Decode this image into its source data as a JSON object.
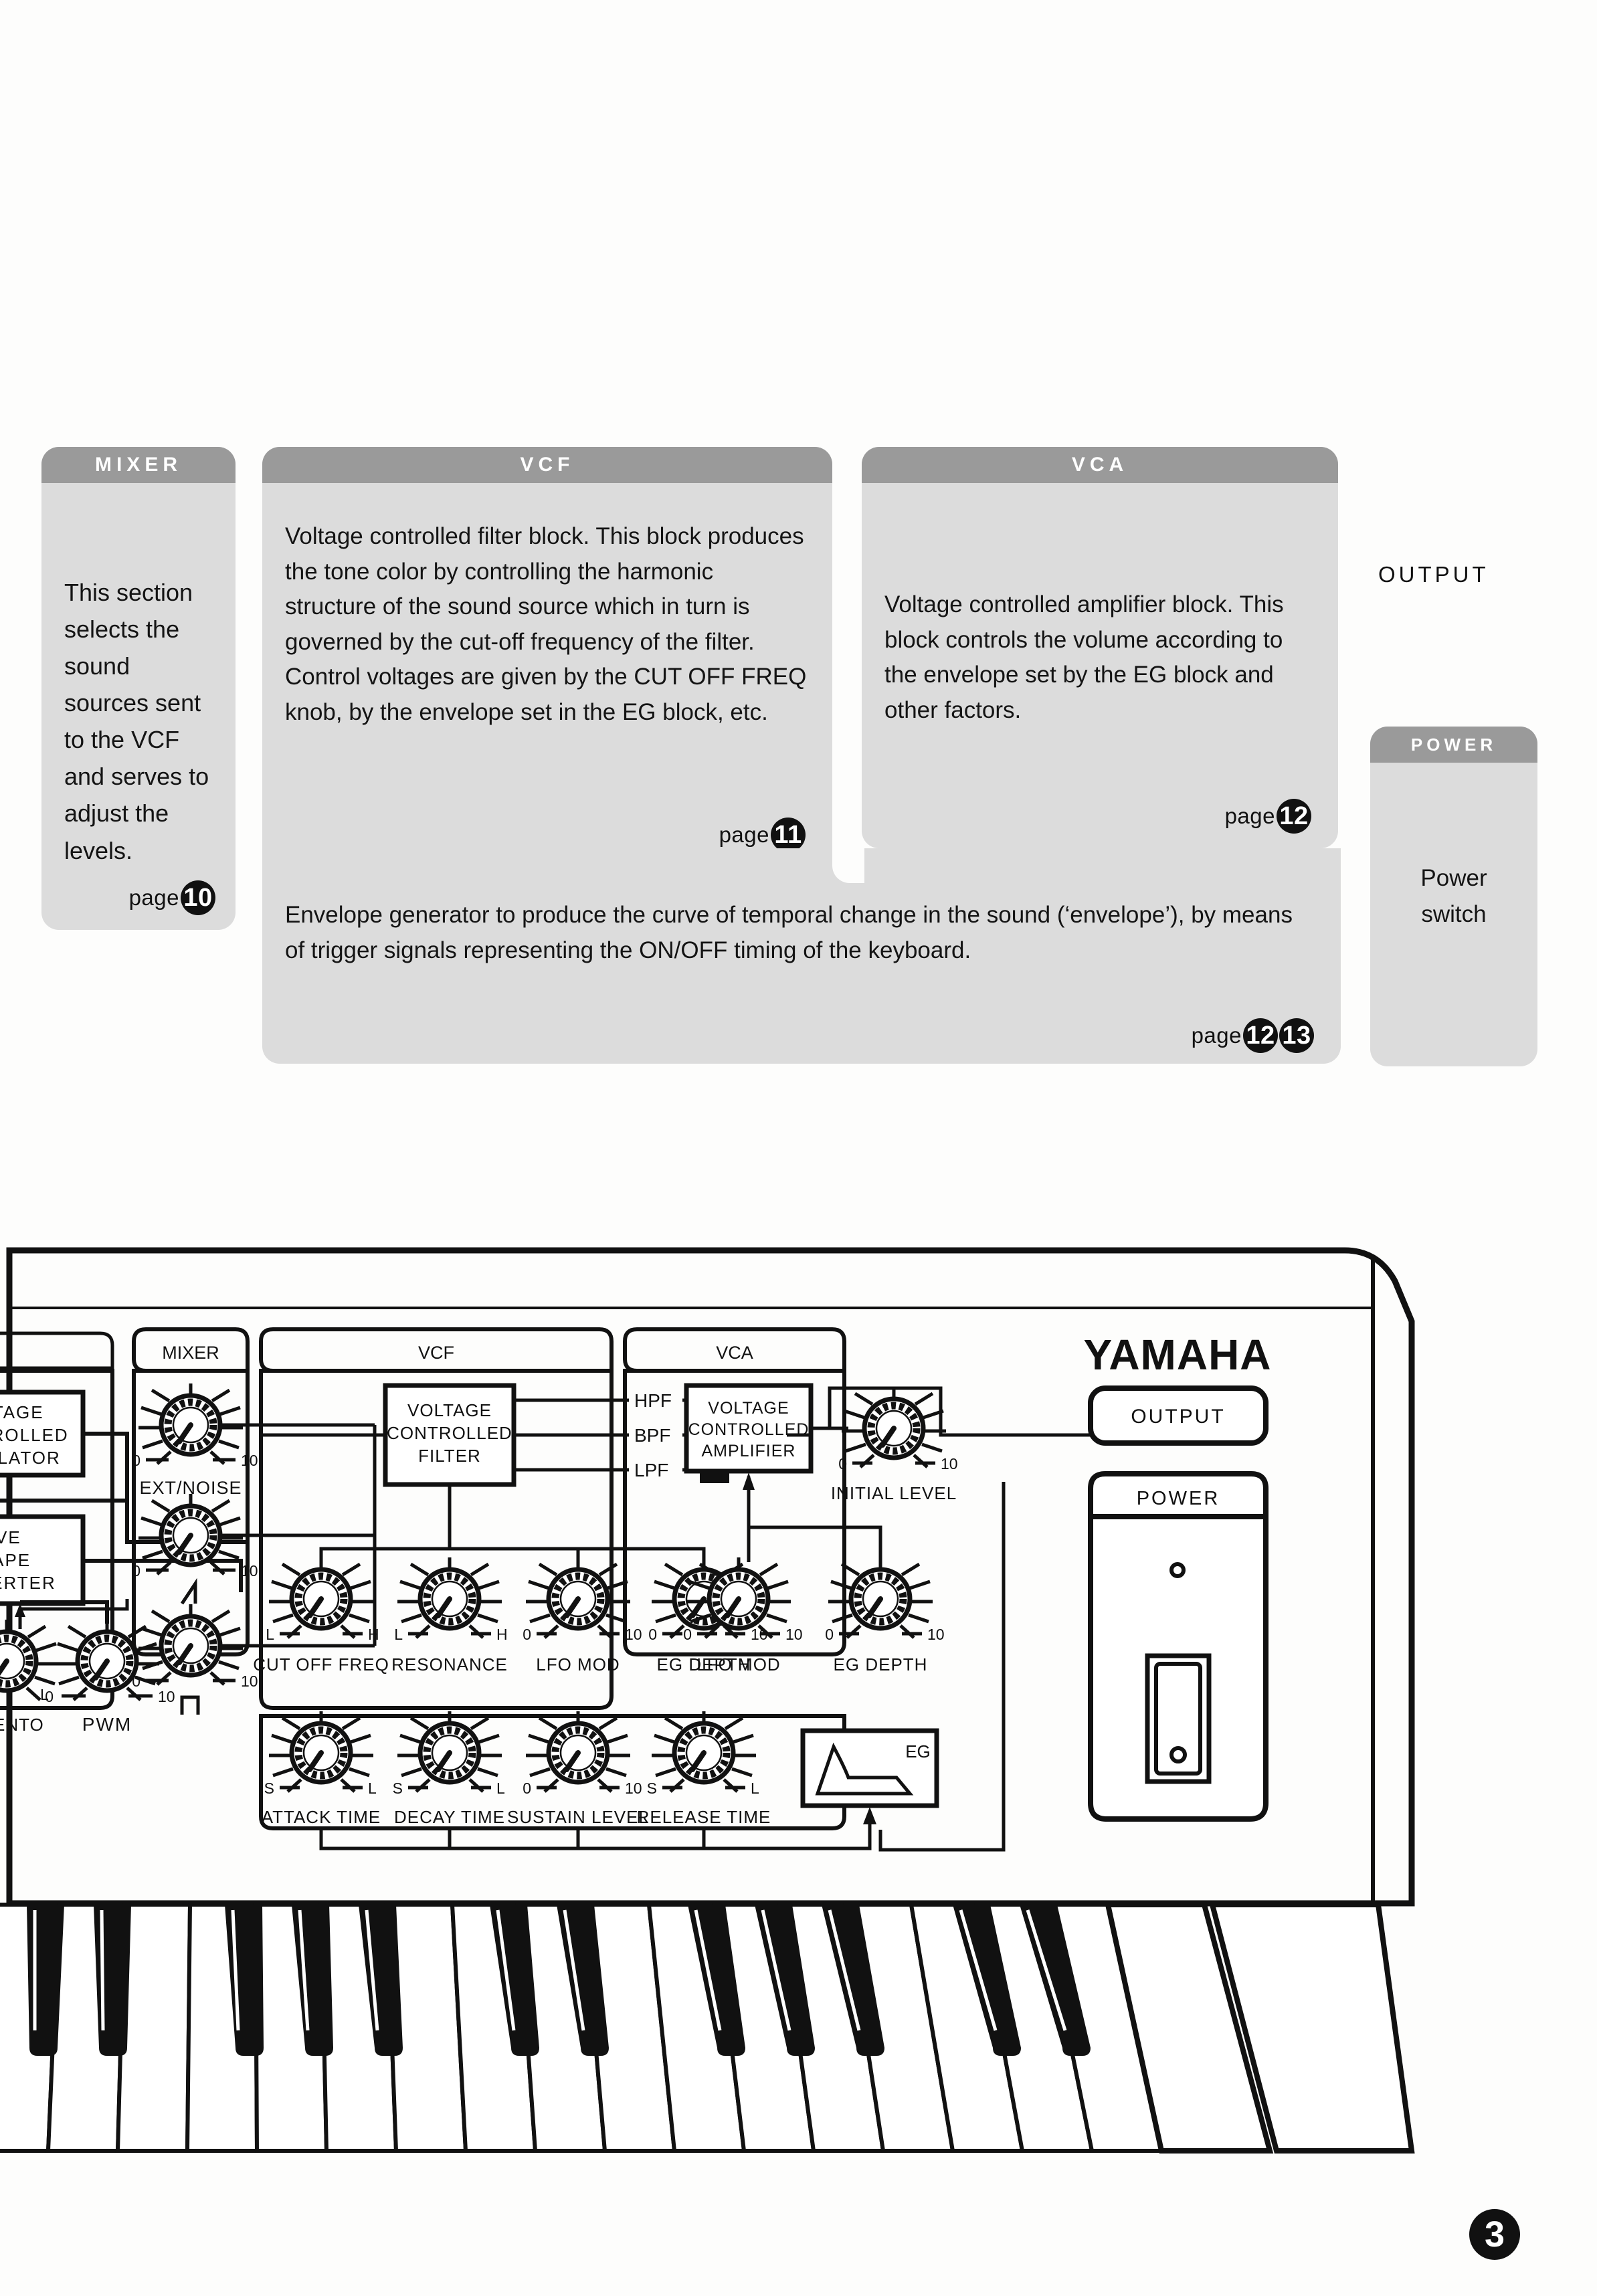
{
  "page_number": "3",
  "callouts": [
    {
      "id": "mixer",
      "title": "MIXER",
      "text": "This section selects the sound sources sent to the VCF and serves to adjust the levels.",
      "page_label": "page",
      "page_refs": [
        "10"
      ]
    },
    {
      "id": "vcf",
      "title": "VCF",
      "text": "Voltage controlled filter block. This block produces the tone color by controlling the harmonic structure of the sound source which in turn is governed by the cut-off frequency of the filter. Control voltages are given by the CUT OFF FREQ knob,  by the envelope set in the EG block, etc.",
      "page_label": "page",
      "page_refs": [
        "11"
      ]
    },
    {
      "id": "vca",
      "title": "VCA",
      "text": "Voltage controlled amplifier block. This block controls the volume according to the envelope set by the EG block and other factors.",
      "page_label": "page",
      "page_refs": [
        "12"
      ]
    },
    {
      "id": "eg",
      "title": "",
      "text": "Envelope generator to produce the curve of temporal change in the sound (‘envelope’), by means of trigger signals representing the ON/OFF timing of the keyboard.",
      "page_label": "page",
      "page_refs": [
        "12",
        "13"
      ]
    },
    {
      "id": "power",
      "title": "POWER",
      "text": "Power switch",
      "page_label": "",
      "page_refs": []
    }
  ],
  "output_label": "OUTPUT",
  "panel": {
    "brand": "YAMAHA",
    "sections": [
      {
        "id": "vco",
        "label": "",
        "truncated": true
      },
      {
        "id": "mixer",
        "label": "MIXER"
      },
      {
        "id": "vcf",
        "label": "VCF"
      },
      {
        "id": "vca",
        "label": "VCA"
      }
    ],
    "vco_blocks": [
      {
        "name": "voltage-controlled-oscillator",
        "lines": [
          "OLTAGE",
          "NTROLLED",
          "CILLATOR"
        ]
      },
      {
        "name": "wave-shape-converter",
        "lines": [
          "WAVE",
          "SHAPE",
          "NVERTER"
        ]
      }
    ],
    "vco_knobs": [
      {
        "label": "ENTO",
        "min": "",
        "max": "L"
      },
      {
        "label": "PWM",
        "min": "0",
        "max": "10"
      }
    ],
    "mixer_knobs": [
      {
        "label": "EXT/NOISE",
        "min": "0",
        "max": "10",
        "symbol": ""
      },
      {
        "label": "",
        "min": "0",
        "max": "10",
        "symbol": "sawtooth"
      },
      {
        "label": "",
        "min": "0",
        "max": "10",
        "symbol": "square"
      }
    ],
    "vcf_block_lines": [
      "VOLTAGE",
      "CONTROLLED",
      "FILTER"
    ],
    "vcf_filter_modes": [
      "HPF",
      "BPF",
      "LPF"
    ],
    "vcf_selected_mode": "LPF",
    "vcf_knobs": [
      {
        "label": "CUT OFF FREQ",
        "min": "L",
        "max": "H"
      },
      {
        "label": "RESONANCE",
        "min": "L",
        "max": "H"
      },
      {
        "label": "LFO MOD",
        "min": "0",
        "max": "10"
      },
      {
        "label": "EG DEPTH",
        "min": "0",
        "max": "10"
      }
    ],
    "eg_knobs": [
      {
        "label": "ATTACK TIME",
        "min": "S",
        "max": "L"
      },
      {
        "label": "DECAY TIME",
        "min": "S",
        "max": "L"
      },
      {
        "label": "SUSTAIN LEVEL",
        "min": "0",
        "max": "10"
      },
      {
        "label": "RELEASE TIME",
        "min": "S",
        "max": "L"
      }
    ],
    "eg_box_label": "EG",
    "vca_block_lines": [
      "VOLTAGE",
      "CONTROLLED",
      "AMPLIFIER"
    ],
    "vca_knobs": [
      {
        "label": "INITIAL LEVEL",
        "min": "0",
        "max": "10"
      },
      {
        "label": "LFO MOD",
        "min": "0",
        "max": "10"
      },
      {
        "label": "EG DEPTH",
        "min": "0",
        "max": "10"
      }
    ],
    "output_button": "OUTPUT",
    "power_label": "POWER"
  },
  "colors": {
    "paper": "#fdfdfc",
    "card_body": "#dcdcdc",
    "card_header": "#9a9a9a",
    "ink": "#111111",
    "header_text": "#ffffff"
  }
}
